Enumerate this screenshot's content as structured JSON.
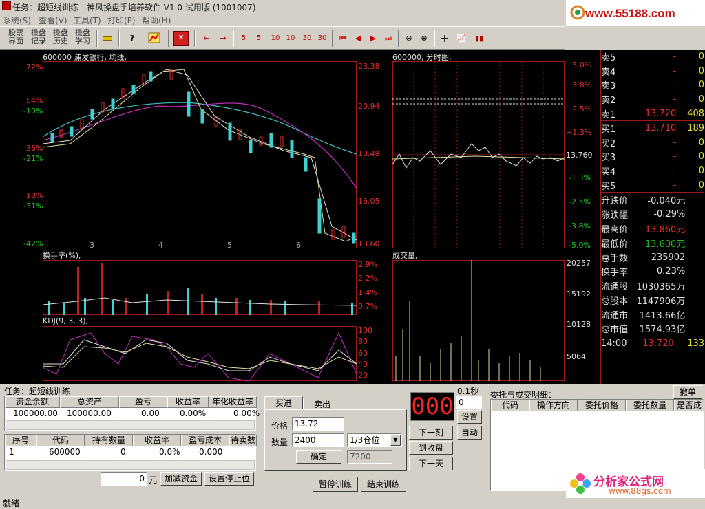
{
  "window": {
    "title": "任务：超短线训练 - 神风操盘手培养软件 V1.0 试用版 (1001007)",
    "min": "_",
    "max": "□",
    "close": "×"
  },
  "menu": [
    "系统(S)",
    "查看(V)",
    "工具(T)",
    "打印(P)",
    "帮助(H)"
  ],
  "toolbar": {
    "btn1": [
      "股票",
      "界面"
    ],
    "btn2": [
      "操盘",
      "记录"
    ],
    "btn3": [
      "操盘",
      "历史"
    ],
    "btn4": [
      "操盘",
      "学习"
    ],
    "nums": [
      "5",
      "5",
      "10",
      "10",
      "30",
      "30"
    ]
  },
  "logo": {
    "url": "www.55188.com"
  },
  "kline": {
    "title": "600000 浦发银行, 均线,",
    "left_pct": [
      "72%",
      "54%",
      "36%",
      "18%"
    ],
    "left_chg": [
      "-10%",
      "-21%",
      "-31%",
      "-42%"
    ],
    "right_prices": [
      "23.38",
      "20.94",
      "18.49",
      "16.05",
      "13.60"
    ],
    "months": [
      "3",
      "4",
      "5",
      "6"
    ]
  },
  "turnover": {
    "title": "换手率(%),",
    "scale": [
      "2.9%",
      "2.2%",
      "1.4%",
      "0.7%"
    ]
  },
  "kdj": {
    "title": "KDJ(9, 3, 3),",
    "scale": [
      "100",
      "80",
      "60",
      "40",
      "20"
    ]
  },
  "minute": {
    "title": "600000, 分时图,",
    "pct_up": [
      "+5.0%",
      "+3.8%",
      "+2.5%",
      "+1.3%"
    ],
    "base": "13.760",
    "pct_dn": [
      "-1.3%",
      "-2.5%",
      "-3.8%",
      "-5.0%"
    ]
  },
  "volume": {
    "title": "成交量,",
    "scale": [
      "20257",
      "15192",
      "10128",
      "5064"
    ]
  },
  "quotes": {
    "sell": [
      {
        "l": "卖5",
        "p": "-",
        "v": "0"
      },
      {
        "l": "卖4",
        "p": "-",
        "v": "0"
      },
      {
        "l": "卖3",
        "p": "-",
        "v": "0"
      },
      {
        "l": "卖2",
        "p": "-",
        "v": "0"
      },
      {
        "l": "卖1",
        "p": "13.720",
        "v": "408"
      }
    ],
    "buy": [
      {
        "l": "买1",
        "p": "13.710",
        "v": "189"
      },
      {
        "l": "买2",
        "p": "-",
        "v": "0"
      },
      {
        "l": "买3",
        "p": "-",
        "v": "0"
      },
      {
        "l": "买4",
        "p": "-",
        "v": "0"
      },
      {
        "l": "买5",
        "p": "-",
        "v": "0"
      }
    ],
    "stats": [
      {
        "l": "升跌价",
        "v": "-0.040元"
      },
      {
        "l": "涨跌幅",
        "v": "-0.29%"
      },
      {
        "l": "最高价",
        "v": "13.860元"
      },
      {
        "l": "最低价",
        "v": "13.600元"
      },
      {
        "l": "总手数",
        "v": "235902"
      },
      {
        "l": "换手率",
        "v": "0.23%"
      },
      {
        "l": "流通股",
        "v": "1030365万"
      },
      {
        "l": "总股本",
        "v": "1147906万"
      },
      {
        "l": "流通市",
        "v": "1413.66亿"
      },
      {
        "l": "总市值",
        "v": "1574.93亿"
      }
    ],
    "tick": {
      "time": "14:00",
      "price": "13.720",
      "vol": "133"
    }
  },
  "task": {
    "label": "任务：超短线训练"
  },
  "account": {
    "headers": [
      "资金余额",
      "总资产",
      "盈亏",
      "收益率",
      "年化收益率"
    ],
    "row": [
      "100000.00",
      "100000.00",
      "0.00",
      "0.00%",
      "0.00%"
    ]
  },
  "holding": {
    "headers": [
      "序号",
      "代码",
      "持有数量",
      "收益率",
      "盈亏成本",
      "待卖数"
    ],
    "row": [
      "1",
      "600000",
      "0",
      "0.0%",
      "0.000",
      ""
    ]
  },
  "funds": {
    "value": "0",
    "unit": "元",
    "add": "加减资金",
    "stop": "设置停止位"
  },
  "order": {
    "tab_buy": "买进",
    "tab_sell": "卖出",
    "price_label": "价格",
    "price": "13.72",
    "qty_label": "数量",
    "qty": "2400",
    "position": "1/3仓位",
    "confirm": "确定",
    "amount": "7200"
  },
  "timer": {
    "display": "000",
    "sec": "0.1秒",
    "sec_val": "0",
    "set": "设置",
    "next_tick": "下一刻",
    "auto": "自动",
    "to_close": "到收盘",
    "next_day": "下一天"
  },
  "train": {
    "pause": "暂停训练",
    "end": "结束训练"
  },
  "entrust": {
    "title": "委托与成交明细：",
    "cancel": "撤单",
    "headers": [
      "代码",
      "操作方向",
      "委托价格",
      "委托数量",
      "是否成"
    ]
  },
  "brand": {
    "name": "分析家公式网",
    "url": "www.88gs.com"
  },
  "status": "就绪"
}
